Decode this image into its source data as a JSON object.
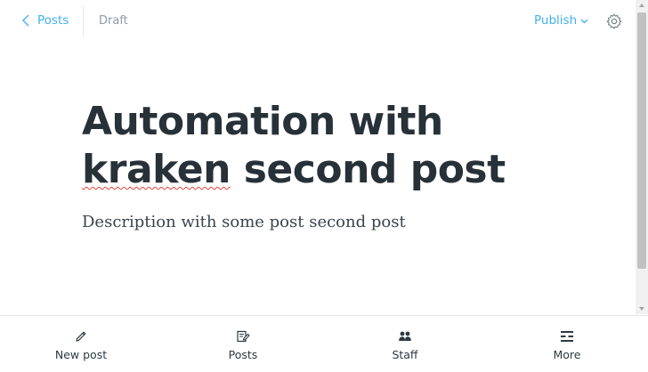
{
  "header": {
    "back_label": "Posts",
    "status": "Draft",
    "publish_label": "Publish"
  },
  "editor": {
    "title_line1": "Automation with",
    "title_misspelled": "kraken",
    "title_rest": " second post",
    "description": "Description with some post second post"
  },
  "bottom_nav": {
    "items": [
      {
        "label": "New post",
        "icon": "pencil-icon"
      },
      {
        "label": "Posts",
        "icon": "posts-icon"
      },
      {
        "label": "Staff",
        "icon": "staff-icon"
      },
      {
        "label": "More",
        "icon": "more-icon"
      }
    ]
  },
  "colors": {
    "accent": "#3eb0ef",
    "title": "#273138",
    "muted": "#8e9cac"
  }
}
